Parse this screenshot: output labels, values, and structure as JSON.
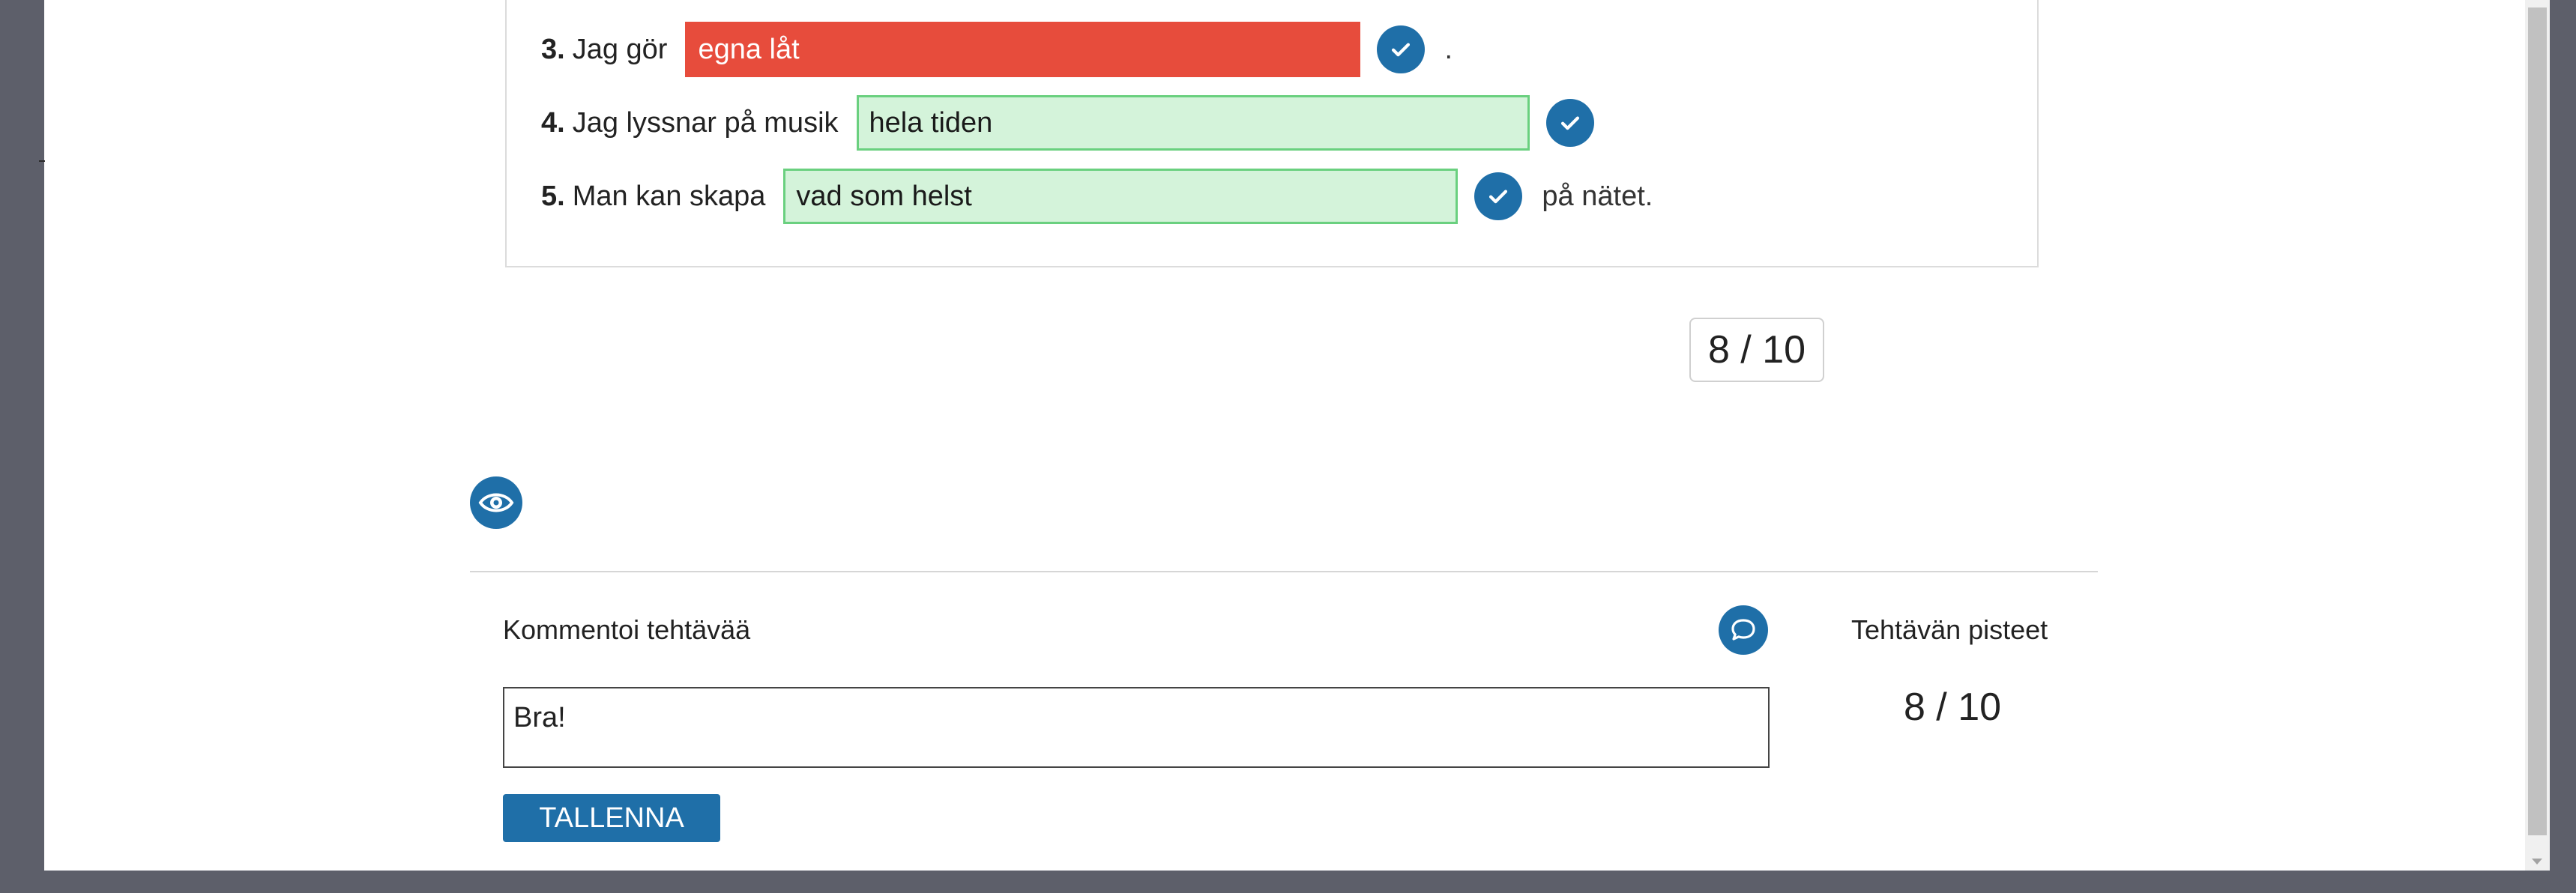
{
  "exercise": {
    "rows": [
      {
        "num": "3.",
        "lead": "Jag gör",
        "answer": "egna låt",
        "status": "wrong",
        "trail": "."
      },
      {
        "num": "4.",
        "lead": "Jag lyssnar på musik",
        "answer": "hela tiden",
        "status": "correct",
        "trail": ""
      },
      {
        "num": "5.",
        "lead": "Man kan skapa",
        "answer": "vad som helst",
        "status": "correct",
        "trail": "på nätet."
      }
    ],
    "score": "8 / 10"
  },
  "comment": {
    "label": "Kommentoi tehtävää",
    "value": "Bra!",
    "save_label": "TALLENNA"
  },
  "points": {
    "label": "Tehtävän pisteet",
    "value": "8 / 10"
  },
  "icons": {
    "check": "check-icon",
    "eye": "eye-icon",
    "comment": "speech-bubble-icon"
  },
  "colors": {
    "accent": "#1f6fa8",
    "wrong": "#e74c3c",
    "correct_bg": "#d4f3da",
    "correct_border": "#6ad07f"
  }
}
